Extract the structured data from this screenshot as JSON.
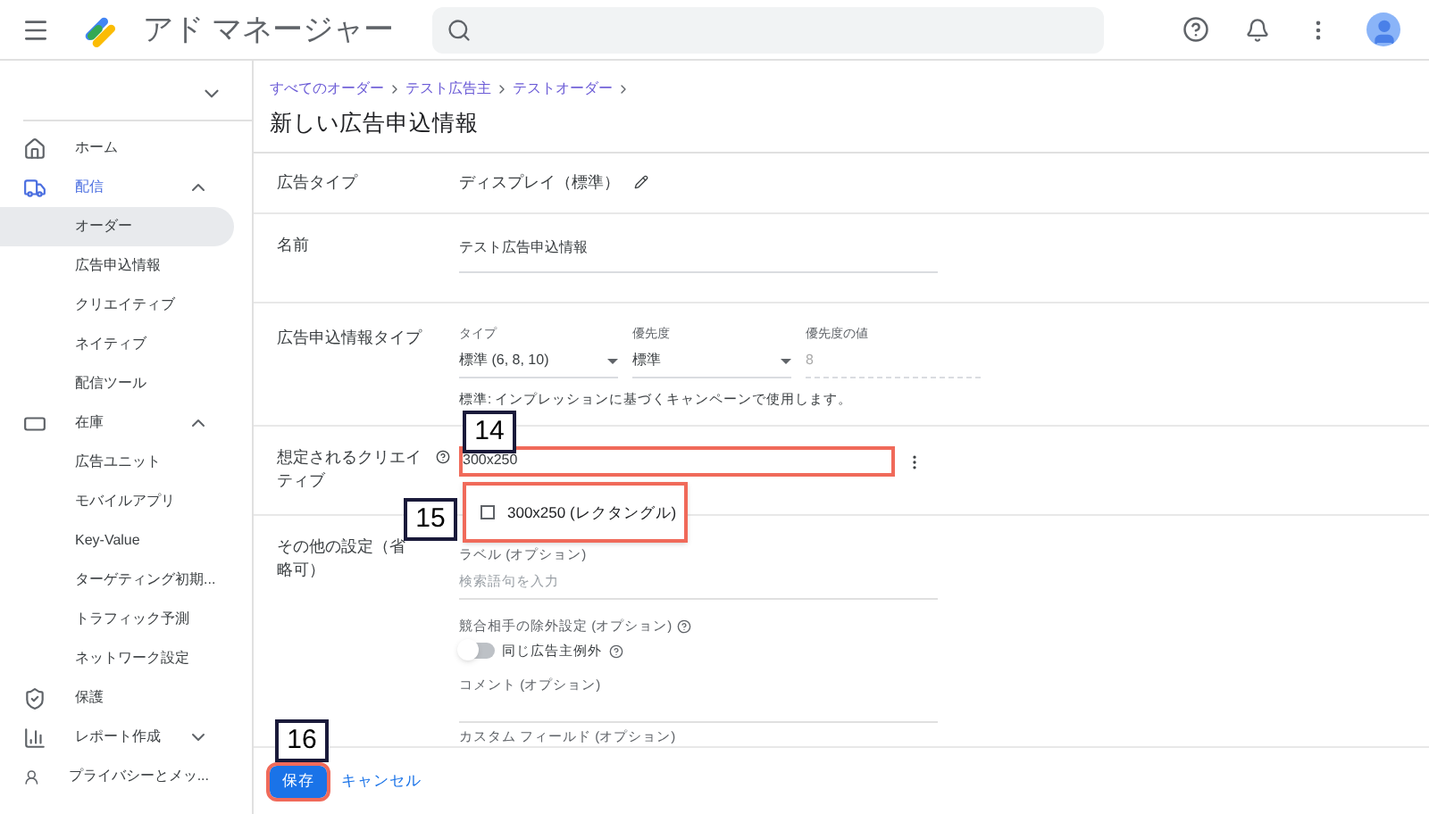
{
  "header": {
    "app_name": "アド マネージャー"
  },
  "sidebar": {
    "items": [
      {
        "label": "ホーム",
        "selected": false
      },
      {
        "label": "配信",
        "selected": false,
        "active": true,
        "expanded": true,
        "children": [
          {
            "label": "オーダー",
            "selected": true
          },
          {
            "label": "広告申込情報",
            "selected": false
          },
          {
            "label": "クリエイティブ",
            "selected": false
          },
          {
            "label": "ネイティブ",
            "selected": false
          },
          {
            "label": "配信ツール",
            "selected": false
          }
        ]
      },
      {
        "label": "在庫",
        "selected": false,
        "active": false,
        "expanded": true,
        "children": [
          {
            "label": "広告ユニット",
            "selected": false
          },
          {
            "label": "モバイルアプリ",
            "selected": false
          },
          {
            "label": "Key-Value",
            "selected": false
          },
          {
            "label": "ターゲティング初期...",
            "selected": false
          },
          {
            "label": "トラフィック予測",
            "selected": false
          },
          {
            "label": "ネットワーク設定",
            "selected": false
          }
        ]
      },
      {
        "label": "保護",
        "selected": false
      },
      {
        "label": "レポート作成",
        "selected": false,
        "active": false,
        "expanded": false
      },
      {
        "label": "プライバシーとメッ...",
        "selected": false
      }
    ]
  },
  "breadcrumb": [
    "すべてのオーダー",
    "テスト広告主",
    "テストオーダー"
  ],
  "page_title": "新しい広告申込情報",
  "form": {
    "ad_type": {
      "label": "広告タイプ",
      "value": "ディスプレイ（標準）"
    },
    "name": {
      "label": "名前",
      "value": "テスト広告申込情報"
    },
    "line_item_type": {
      "label": "広告申込情報タイプ",
      "type_label": "タイプ",
      "type_value": "標準 (6, 8, 10)",
      "priority_label": "優先度",
      "priority_value": "標準",
      "priority_value_label": "優先度の値",
      "priority_value_value": "8",
      "help": "標準: インプレッションに基づくキャンペーンで使用します。"
    },
    "expected_creatives": {
      "label": "想定されるクリエイティブ",
      "value": "300x250",
      "option": {
        "label": "300x250 (レクタングル)",
        "checked": false
      }
    },
    "other": {
      "label": "その他の設定（省略可）",
      "label_field": "ラベル (オプション)",
      "label_placeholder": "検索語句を入力",
      "competitive_label": "競合相手の除外設定 (オプション)",
      "toggle": {
        "label": "同じ広告主例外",
        "on": false
      },
      "comment_label": "コメント (オプション)",
      "custom_label": "カスタム フィールド (オプション)"
    }
  },
  "footer": {
    "save": "保存",
    "cancel": "キャンセル"
  },
  "annotations": [
    "14",
    "15",
    "16"
  ]
}
